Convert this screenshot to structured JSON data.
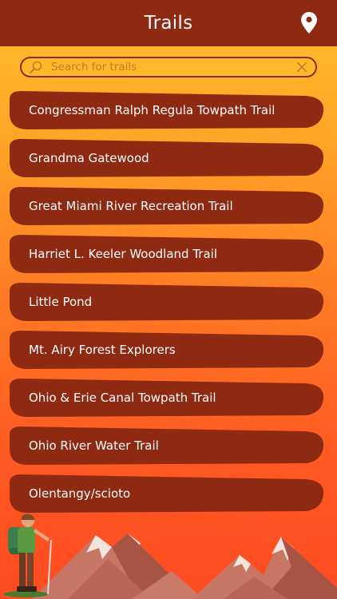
{
  "header": {
    "title": "Trails",
    "location_icon": "map-pin-icon"
  },
  "search": {
    "placeholder": "Search for trails",
    "value": "",
    "search_icon": "magnifier-icon",
    "clear_icon": "close-icon"
  },
  "trails": [
    {
      "label": "Congressman Ralph Regula Towpath Trail"
    },
    {
      "label": "Grandma Gatewood"
    },
    {
      "label": "Great Miami River Recreation Trail"
    },
    {
      "label": "Harriet L. Keeler Woodland Trail"
    },
    {
      "label": "Little Pond"
    },
    {
      "label": "Mt. Airy Forest Explorers"
    },
    {
      "label": "Ohio & Erie Canal Towpath Trail"
    },
    {
      "label": "Ohio River Water Trail"
    },
    {
      "label": "Olentangy/scioto"
    }
  ],
  "colors": {
    "header_bg": "#8f2a12",
    "item_bg": "#8f2a12",
    "text": "#ffffff",
    "gradient_top": "#ffc02a",
    "gradient_bottom": "#ff4b22"
  }
}
